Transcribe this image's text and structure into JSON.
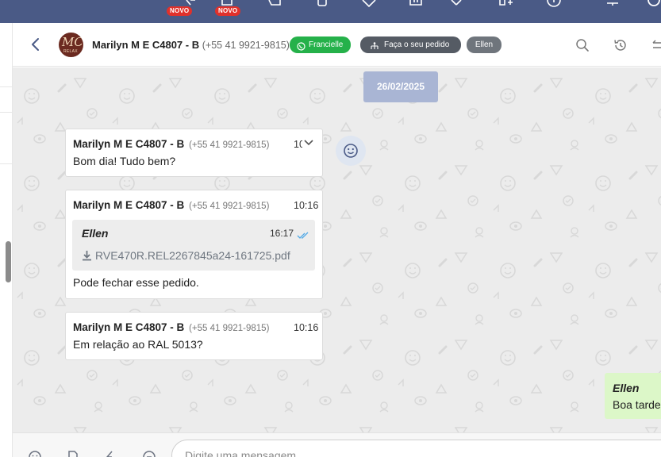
{
  "topbar": {
    "badges": [
      "NOVO",
      "NOVO"
    ],
    "icons": [
      "bookmark-new-icon",
      "clipboard-new-icon",
      "chat-icon",
      "mobile-icon",
      "heart-icon",
      "building-icon",
      "tools-icon",
      "add-user-icon",
      "info-icon",
      "bell-icon",
      "settings-icon"
    ]
  },
  "header": {
    "avatar_mark": "MC",
    "avatar_sub": "RELAX",
    "contact_name": "Marilyn M E C4807 - B",
    "contact_phone": "(+55 41 9921-9815)",
    "chips": {
      "whatsapp_agent": "Francielle",
      "order_button": "Faça o seu pedido",
      "assigned": "Ellen"
    }
  },
  "chat": {
    "date_badge": "26/02/2025",
    "messages": [
      {
        "sender_name": "Marilyn M E C4807 - B",
        "sender_phone": "(+55 41 9921-9815)",
        "time": "10",
        "text": "Bom dia! Tudo bem?"
      },
      {
        "sender_name": "Marilyn M E C4807 - B",
        "sender_phone": "(+55 41 9921-9815)",
        "time": "10:16",
        "quote": {
          "author": "Ellen",
          "time": "16:17",
          "file": "RVE470R.REL2267845a24-161725.pdf"
        },
        "text": "Pode fechar esse pedido."
      },
      {
        "sender_name": "Marilyn M E C4807 - B",
        "sender_phone": "(+55 41 9921-9815)",
        "time": "10:16",
        "text": "Em relação ao RAL 5013?"
      }
    ],
    "outgoing": {
      "author": "Ellen",
      "text": "Boa tarde"
    }
  },
  "composer": {
    "placeholder": "Digite uma mensagem"
  },
  "colors": {
    "topbar": "#4a5a86",
    "whatsapp_chip": "#25b14a",
    "order_chip": "#555b64",
    "assigned_chip": "#6f757c",
    "date_badge": "#a9b5d4",
    "chat_background": "#ececec",
    "outgoing_bubble": "#dcf7c8",
    "new_badge": "#e0312b",
    "read_ticks": "#4fa8e6"
  }
}
